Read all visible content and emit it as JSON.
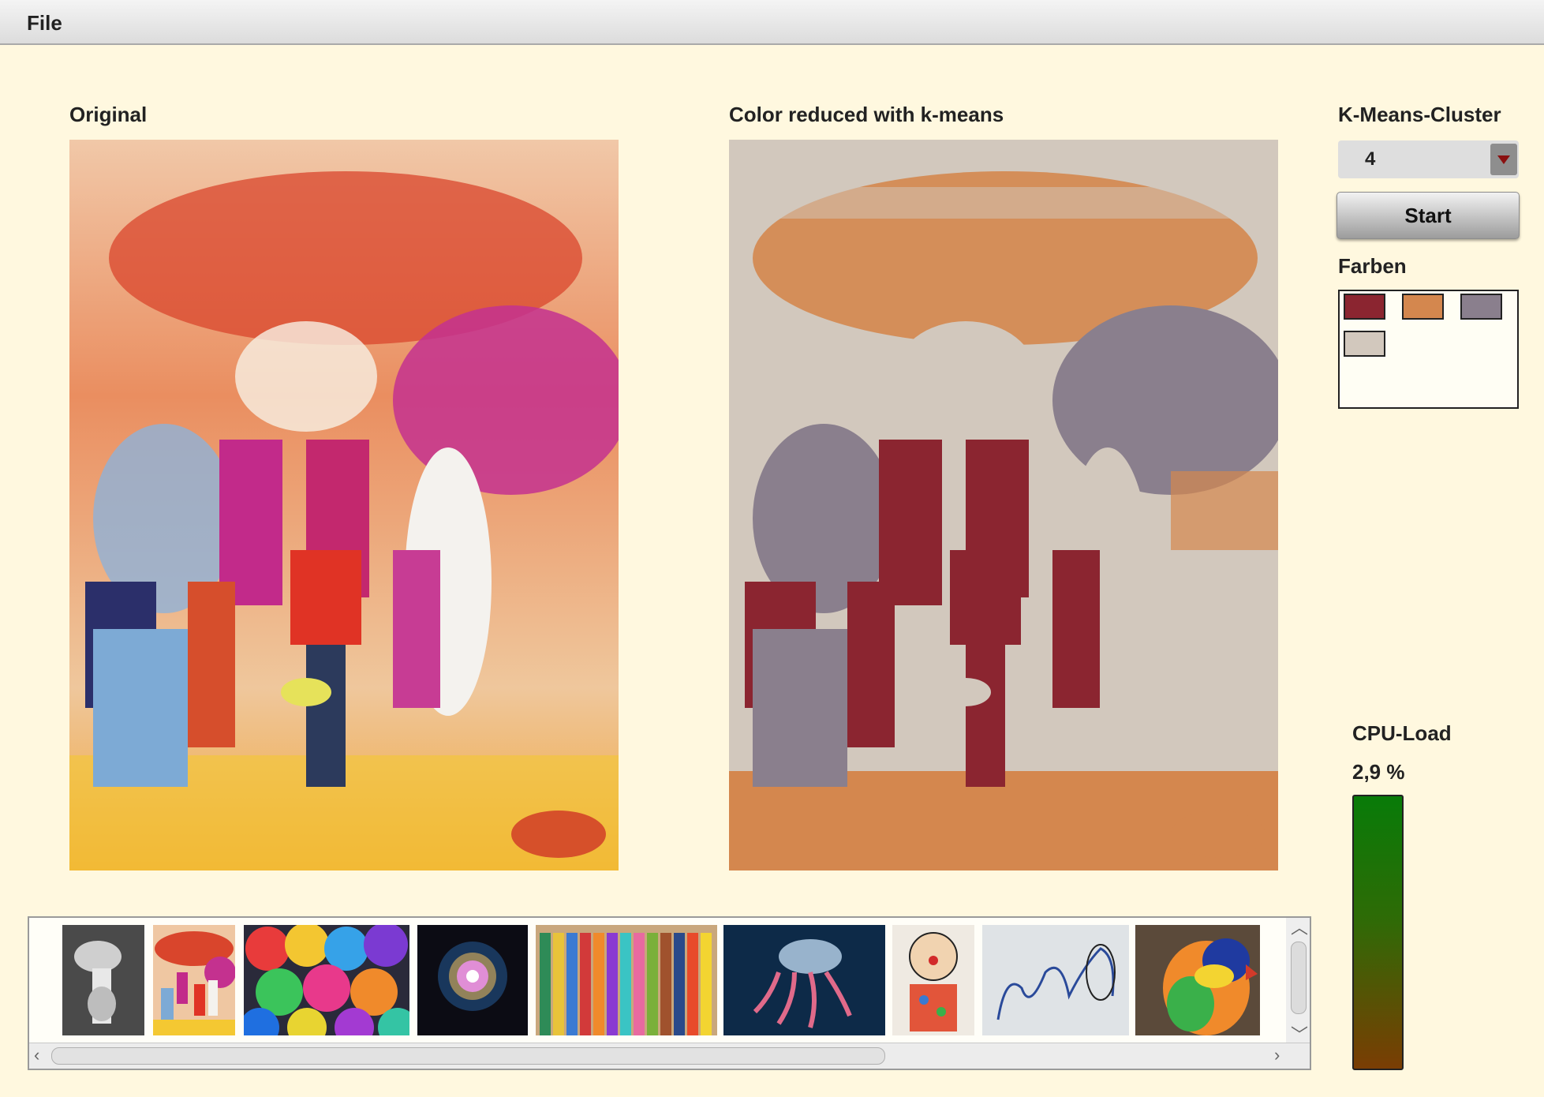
{
  "menu": {
    "file_label": "File"
  },
  "panels": {
    "original_label": "Original",
    "reduced_label": "Color reduced with k-means"
  },
  "controls": {
    "cluster_label": "K-Means-Cluster",
    "cluster_value": "4",
    "start_label": "Start",
    "colors_label": "Farben",
    "swatches": [
      "#8b2530",
      "#d4874e",
      "#8a7f8d",
      "#d2c8bd"
    ]
  },
  "cpu": {
    "label": "CPU-Load",
    "value_text": "2,9 %"
  },
  "gallery": {
    "thumbnails": [
      "gray-sketch-thumbnail",
      "colorful-painting-thumbnail",
      "rainbow-roses-thumbnail",
      "nebula-thumbnail",
      "colored-pencils-thumbnail",
      "jellyfish-thumbnail",
      "clown-drawing-thumbnail",
      "blue-ink-drawing-thumbnail",
      "parrot-thumbnail"
    ]
  }
}
